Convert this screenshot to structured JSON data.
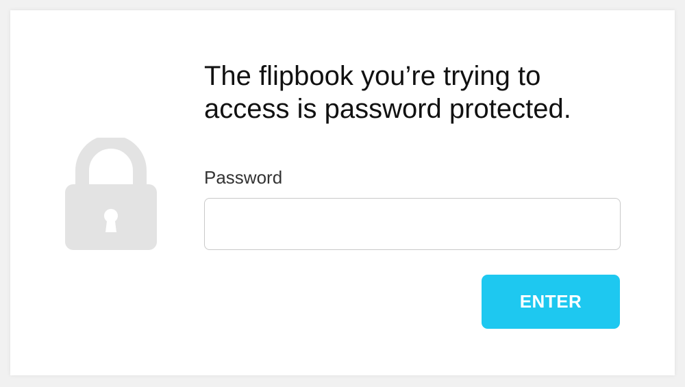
{
  "dialog": {
    "title": "The flipbook you’re trying to\naccess is password protected.",
    "password_label": "Password",
    "password_value": "",
    "password_placeholder": "",
    "enter_label": "ENTER"
  },
  "icons": {
    "lock": "lock-icon"
  },
  "colors": {
    "accent": "#1ec8f0",
    "lock": "#e3e3e3",
    "input_border": "#c8c8c8",
    "title_text": "#111111"
  }
}
